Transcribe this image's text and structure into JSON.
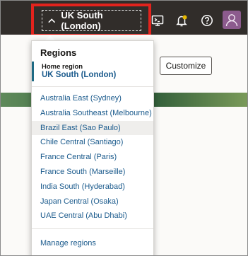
{
  "topbar": {
    "region_button_label": "UK South (London)",
    "icons": [
      "chevron-up-icon",
      "cloud-shell-icon",
      "notifications-icon",
      "help-icon",
      "user-avatar"
    ]
  },
  "background": {
    "customize_label": "Customize"
  },
  "dropdown": {
    "title": "Regions",
    "home_label": "Home region",
    "home_value": "UK South (London)",
    "regions": [
      {
        "label": "Australia East (Sydney)",
        "highlighted": false
      },
      {
        "label": "Australia Southeast (Melbourne)",
        "highlighted": false
      },
      {
        "label": "Brazil East (Sao Paulo)",
        "highlighted": true
      },
      {
        "label": "Chile Central (Santiago)",
        "highlighted": false
      },
      {
        "label": "France Central (Paris)",
        "highlighted": false
      },
      {
        "label": "France South (Marseille)",
        "highlighted": false
      },
      {
        "label": "India South (Hyderabad)",
        "highlighted": false
      },
      {
        "label": "Japan Central (Osaka)",
        "highlighted": false
      },
      {
        "label": "UAE Central (Abu Dhabi)",
        "highlighted": false
      }
    ],
    "manage_label": "Manage regions"
  },
  "colors": {
    "topbar_bg": "#312d2a",
    "highlight_border": "#e3231d",
    "link": "#1a5a8c",
    "home_accent": "#1e6a84"
  }
}
